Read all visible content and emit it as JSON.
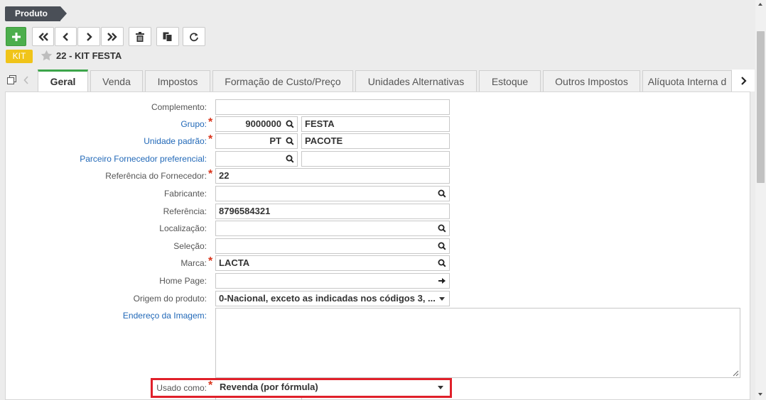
{
  "breadcrumb": {
    "label": "Produto"
  },
  "header": {
    "badge": "KIT",
    "title": "22 - KIT FESTA"
  },
  "toolbar": {
    "buttons": [
      "add",
      "first",
      "previous",
      "next",
      "last",
      "delete",
      "duplicate",
      "refresh"
    ]
  },
  "tabs": [
    {
      "label": "Geral",
      "active": true
    },
    {
      "label": "Venda"
    },
    {
      "label": "Impostos"
    },
    {
      "label": "Formação de Custo/Preço"
    },
    {
      "label": "Unidades Alternativas"
    },
    {
      "label": "Estoque"
    },
    {
      "label": "Outros Impostos"
    },
    {
      "label": "Alíquota Interna d"
    }
  ],
  "form": {
    "complemento": {
      "label": "Complemento:",
      "value": ""
    },
    "grupo": {
      "label": "Grupo:",
      "code": "9000000",
      "desc": "FESTA"
    },
    "unidade": {
      "label": "Unidade padrão:",
      "code": "PT",
      "desc": "PACOTE"
    },
    "parceiro": {
      "label": "Parceiro Fornecedor preferencial:",
      "code": "",
      "desc": ""
    },
    "ref_fornecedor": {
      "label": "Referência do Fornecedor:",
      "value": "22"
    },
    "fabricante": {
      "label": "Fabricante:",
      "value": ""
    },
    "referencia": {
      "label": "Referência:",
      "value": "8796584321"
    },
    "localizacao": {
      "label": "Localização:",
      "value": ""
    },
    "selecao": {
      "label": "Seleção:",
      "value": ""
    },
    "marca": {
      "label": "Marca:",
      "value": "LACTA"
    },
    "home_page": {
      "label": "Home Page:",
      "value": ""
    },
    "origem": {
      "label": "Origem do produto:",
      "value": "0-Nacional, exceto as indicadas nos códigos 3, ..."
    },
    "endereco_imagem": {
      "label": "Endereço da Imagem:",
      "value": ""
    },
    "usado_como": {
      "label": "Usado como:",
      "value": "Revenda (por fórmula)"
    }
  },
  "colors": {
    "accent_green": "#3ca54a",
    "required": "#d9341b",
    "link": "#2269b8",
    "highlight": "#e0202a",
    "badge": "#f0c419"
  }
}
